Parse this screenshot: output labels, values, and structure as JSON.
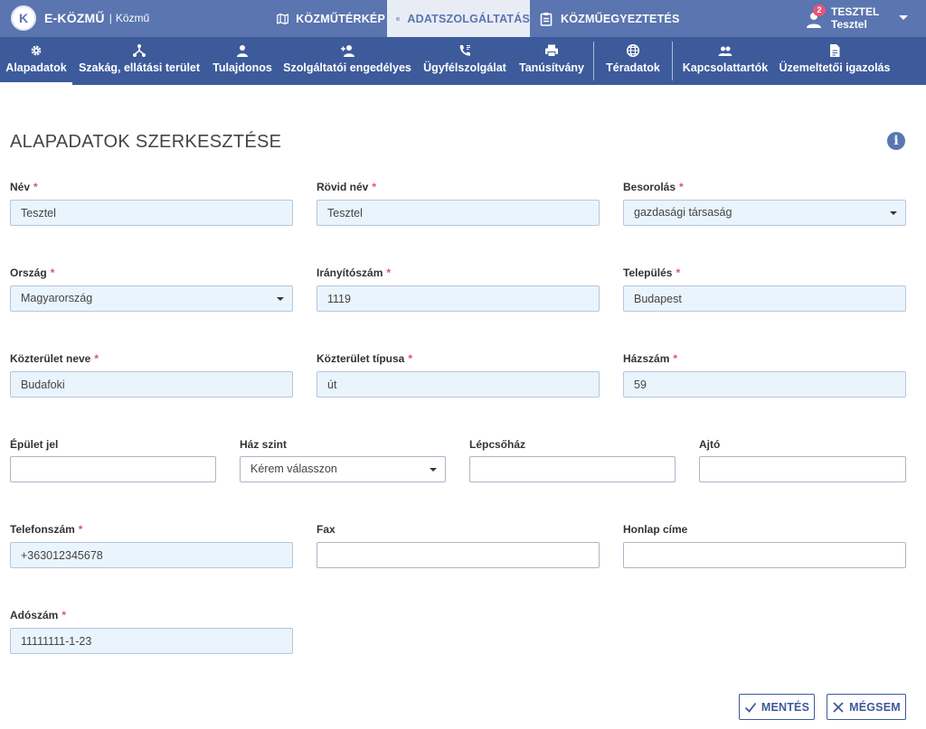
{
  "app": {
    "logo_letter": "K",
    "name": "E-KÖZMŰ",
    "separator": "|",
    "subtitle": "Közmű"
  },
  "top_nav": [
    {
      "label": "KÖZMŰTÉRKÉP",
      "icon": "map-icon"
    },
    {
      "label": "ADATSZOLGÁLTATÁS",
      "icon": "form-icon",
      "active": true
    },
    {
      "label": "KÖZMŰEGYEZTETÉS",
      "icon": "clipboard-icon"
    }
  ],
  "user": {
    "badge": "2",
    "name": "TESZTEL",
    "sub": "Tesztel"
  },
  "sub_nav": [
    {
      "label": "Alapadatok",
      "icon": "gear-icon",
      "active": true
    },
    {
      "label": "Szakág, ellátási terület",
      "icon": "network-icon"
    },
    {
      "label": "Tulajdonos",
      "icon": "person-icon"
    },
    {
      "label": "Szolgáltatói engedélyes",
      "icon": "add-person-icon"
    },
    {
      "label": "Ügyfélszolgálat",
      "icon": "phone-icon"
    },
    {
      "label": "Tanúsítvány",
      "icon": "printer-icon"
    },
    {
      "label": "Téradatok",
      "icon": "globe-icon"
    },
    {
      "label": "Kapcsolattartók",
      "icon": "people-icon"
    },
    {
      "label": "Üzemeltetői igazolás",
      "icon": "document-icon"
    }
  ],
  "page": {
    "title": "ALAPADATOK SZERKESZTÉSE",
    "info_symbol": "i"
  },
  "form": {
    "required_mark": "*",
    "nev": {
      "label": "Név",
      "value": "Tesztel"
    },
    "rovid_nev": {
      "label": "Rövid név",
      "value": "Tesztel"
    },
    "besorolas": {
      "label": "Besorolás",
      "value": "gazdasági társaság"
    },
    "orszag": {
      "label": "Ország",
      "value": "Magyarország"
    },
    "iranyitoszam": {
      "label": "Irányítószám",
      "value": "1119"
    },
    "telepules": {
      "label": "Település",
      "value": "Budapest"
    },
    "kozterulet_neve": {
      "label": "Közterület neve",
      "value": "Budafoki"
    },
    "kozterulet_tipusa": {
      "label": "Közterület típusa",
      "value": "út"
    },
    "hazszam": {
      "label": "Házszám",
      "value": "59"
    },
    "epulet_jel": {
      "label": "Épület jel",
      "value": ""
    },
    "haz_szint": {
      "label": "Ház szint",
      "value": "Kérem válasszon"
    },
    "lepcsohaz": {
      "label": "Lépcsőház",
      "value": ""
    },
    "ajto": {
      "label": "Ajtó",
      "value": ""
    },
    "telefonszam": {
      "label": "Telefonszám",
      "value": "+363012345678"
    },
    "fax": {
      "label": "Fax",
      "value": ""
    },
    "honlap": {
      "label": "Honlap címe",
      "value": ""
    },
    "adoszam": {
      "label": "Adószám",
      "value": "11111111-1-23"
    }
  },
  "actions": {
    "save": "MENTÉS",
    "cancel": "MÉGSEM"
  }
}
